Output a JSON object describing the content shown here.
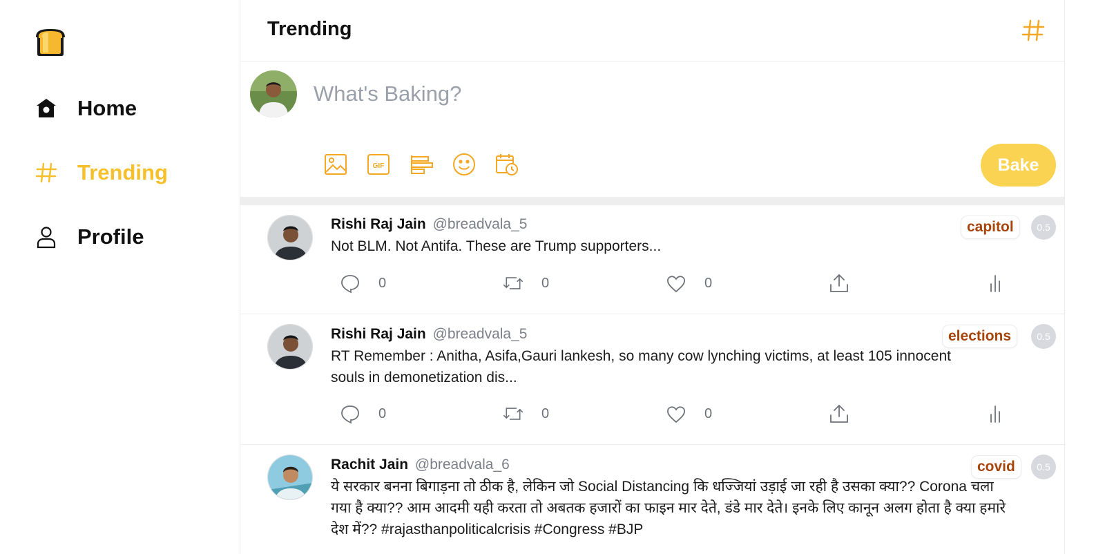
{
  "app": {
    "accent": "#f5c02b",
    "logo_icon": "bread-logo-icon"
  },
  "sidebar": {
    "items": [
      {
        "label": "Home",
        "icon": "home-icon",
        "active": false
      },
      {
        "label": "Trending",
        "icon": "hashtag-icon",
        "active": true
      },
      {
        "label": "Profile",
        "icon": "user-icon",
        "active": false
      }
    ]
  },
  "header": {
    "title": "Trending",
    "right_icon": "hashtag-icon"
  },
  "composer": {
    "placeholder": "What's Baking?",
    "tools": [
      "image-icon",
      "gif-icon",
      "poll-icon",
      "emoji-icon",
      "schedule-icon"
    ],
    "submit_label": "Bake",
    "submit_color": "#fad352"
  },
  "feed": {
    "posts": [
      {
        "name": "Rishi Raj Jain",
        "handle": "@breadvala_5",
        "text": "Not BLM. Not Antifa. These are Trump supporters...",
        "tag": "capitol",
        "score": "0.5",
        "replies": "0",
        "retweets": "0",
        "likes": "0"
      },
      {
        "name": "Rishi Raj Jain",
        "handle": "@breadvala_5",
        "text": "RT Remember : Anitha, Asifa,Gauri lankesh, so many cow lynching victims, at least 105 innocent souls in demonetization dis...",
        "tag": "elections",
        "score": "0.5",
        "replies": "0",
        "retweets": "0",
        "likes": "0"
      },
      {
        "name": "Rachit Jain",
        "handle": "@breadvala_6",
        "text": "ये सरकार बनना बिगाड़ना तो ठीक है, लेकिन जो Social Distancing कि धज्जियां उड़ाई जा रही है उसका क्या?? Corona चला गया है क्या?? आम आदमी यही करता तो अबतक हजारों का फाइन मार देते, डंडे मार देते। इनके लिए कानून अलग होता है क्या हमारे देश में?? #rajasthanpoliticalcrisis #Congress #BJP",
        "tag": "covid",
        "score": "0.5"
      }
    ],
    "tag_color": "#a7440a",
    "score_color": "#d7d9de"
  }
}
